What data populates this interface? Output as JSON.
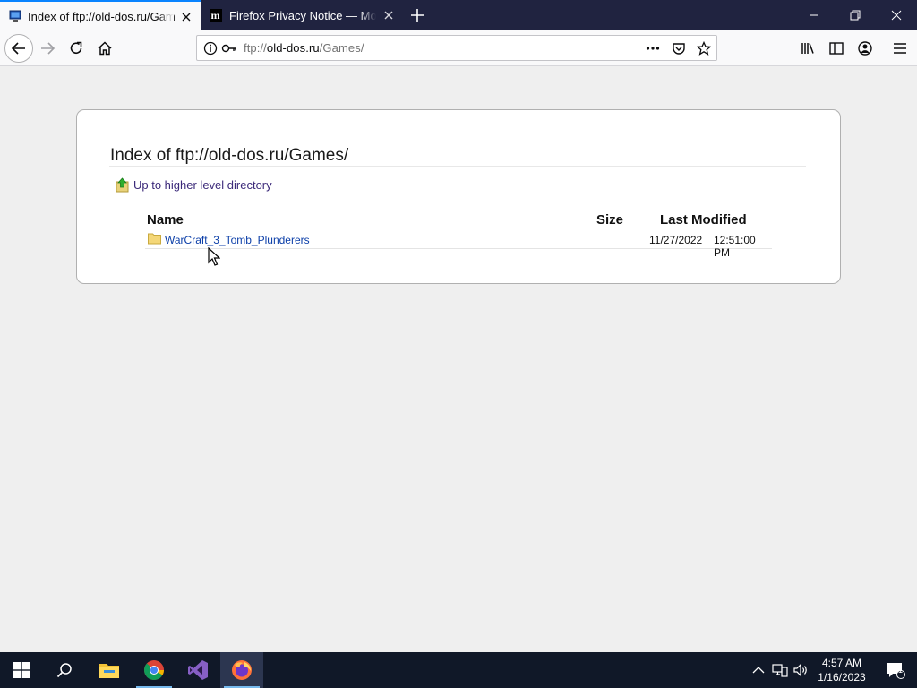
{
  "browser": {
    "tabs": [
      {
        "label": "Index of ftp://old-dos.ru/Games/",
        "active": true
      },
      {
        "label": "Firefox Privacy Notice — Mozilla",
        "active": false
      }
    ],
    "url": {
      "prefix": "ftp://",
      "host": "old-dos.ru",
      "path": "/Games/"
    }
  },
  "page": {
    "title": "Index of ftp://old-dos.ru/Games/",
    "up_link": "Up to higher level directory",
    "columns": {
      "name": "Name",
      "size": "Size",
      "modified": "Last Modified"
    },
    "rows": [
      {
        "name": "WarCraft_3_Tomb_Plunderers",
        "size": "",
        "date": "11/27/2022",
        "time": "12:51:00 PM"
      }
    ]
  },
  "taskbar": {
    "time": "4:57 AM",
    "date": "1/16/2023",
    "notification_count": "1"
  },
  "colors": {
    "tab_strip": "#202340",
    "accent": "#0a84ff",
    "link": "#0b3ea8",
    "taskbar": "#101828"
  }
}
